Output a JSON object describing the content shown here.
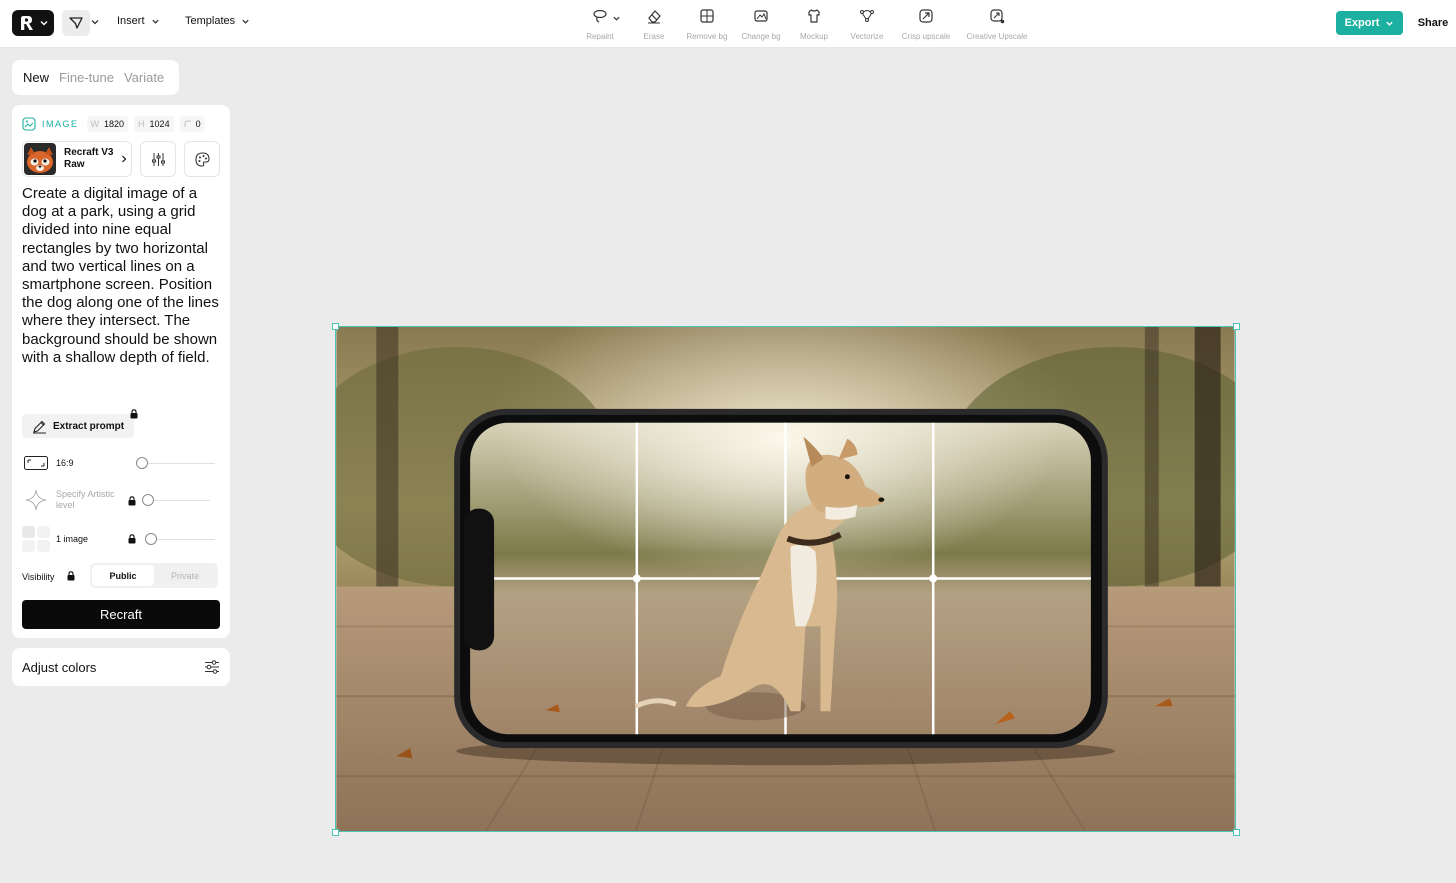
{
  "topbar": {
    "insert_label": "Insert",
    "templates_label": "Templates",
    "tools": [
      {
        "label": "Repaint",
        "icon": "lasso-icon"
      },
      {
        "label": "Erase",
        "icon": "eraser-icon"
      },
      {
        "label": "Remove bg",
        "icon": "remove-bg-icon"
      },
      {
        "label": "Change bg",
        "icon": "change-bg-icon"
      },
      {
        "label": "Mockup",
        "icon": "shirt-icon"
      },
      {
        "label": "Vectorize",
        "icon": "vector-nodes-icon"
      },
      {
        "label": "Crisp upscale",
        "icon": "upscale-icon"
      },
      {
        "label": "Creative Upscale",
        "icon": "creative-upscale-icon"
      }
    ],
    "export_label": "Export",
    "share_label": "Share",
    "accent_color": "#1bb0a0"
  },
  "mode_tabs": [
    "New",
    "Fine-tune",
    "Variate"
  ],
  "panel": {
    "image_label": "IMAGE",
    "width_key": "W",
    "width_value": "1820",
    "height_key": "H",
    "height_value": "1024",
    "rotation_value": "0",
    "model_name": "Recraft V3 Raw",
    "prompt": "Create a digital image of a dog at a park, using a grid divided into nine equal rectangles by two horizontal and two vertical lines on a smartphone screen. Position the dog along one of the lines where they intersect. The background should be shown with a shallow depth of field.",
    "extract_prompt_label": "Extract prompt",
    "aspect_ratio": "16:9",
    "artistic_level_label": "Specify Artistic level",
    "image_count": "1 image",
    "visibility_label": "Visibility",
    "visibility_options": [
      "Public",
      "Private"
    ],
    "visibility_selected": "Public",
    "recraft_label": "Recraft"
  },
  "adjust_colors_label": "Adjust colors"
}
